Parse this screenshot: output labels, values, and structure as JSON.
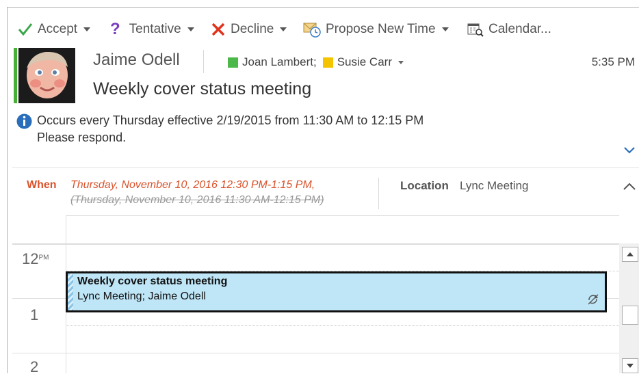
{
  "toolbar": {
    "accept": "Accept",
    "tentative": "Tentative",
    "decline": "Decline",
    "propose": "Propose New Time",
    "calendar": "Calendar..."
  },
  "header": {
    "sender": "Jaime Odell",
    "recipients": [
      {
        "name": "Joan Lambert;",
        "color": "#4db84a"
      },
      {
        "name": "Susie Carr",
        "color": "#f5c400"
      }
    ],
    "time": "5:35 PM",
    "subject": "Weekly cover status meeting"
  },
  "info": {
    "line1": "Occurs every Thursday effective 2/19/2015 from 11:30 AM to 12:15 PM",
    "line2": "Please respond."
  },
  "details": {
    "when_label": "When",
    "when_value": "Thursday, November 10, 2016 12:30 PM-1:15 PM,",
    "when_previous": "(Thursday, November 10, 2016 11:30 AM-12:15 PM)",
    "location_label": "Location",
    "location_value": "Lync Meeting"
  },
  "calendar": {
    "hours": [
      {
        "hour": "12",
        "suffix": "PM"
      },
      {
        "hour": "1",
        "suffix": ""
      },
      {
        "hour": "2",
        "suffix": ""
      }
    ],
    "meeting": {
      "title": "Weekly cover status meeting",
      "subtitle": "Lync Meeting; Jaime Odell",
      "color": "#bfe6f7"
    }
  },
  "colors": {
    "accent_green": "#45b035",
    "when_red": "#d9532c",
    "info_blue": "#2a6ebb"
  }
}
